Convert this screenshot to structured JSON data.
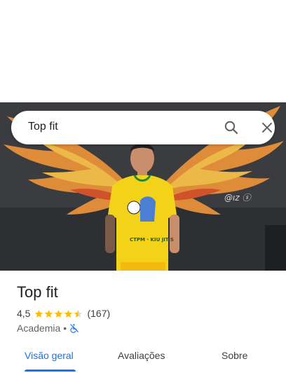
{
  "search": {
    "query": "Top fit"
  },
  "place": {
    "name": "Top fit",
    "rating": "4,5",
    "stars": 4.5,
    "review_count": "(167)",
    "category": "Academia",
    "separator": "•"
  },
  "tabs": [
    {
      "label": "Visão geral",
      "active": true
    },
    {
      "label": "Avaliações",
      "active": false
    },
    {
      "label": "Sobre",
      "active": false
    }
  ],
  "colors": {
    "accent": "#1a73e8",
    "star": "#fbbc04",
    "wall": "#3a3b3e",
    "shirt": "#f2d319"
  },
  "icons": {
    "search": "search-icon",
    "close": "close-icon",
    "accessibility": "not-wheelchair-accessible-icon"
  }
}
